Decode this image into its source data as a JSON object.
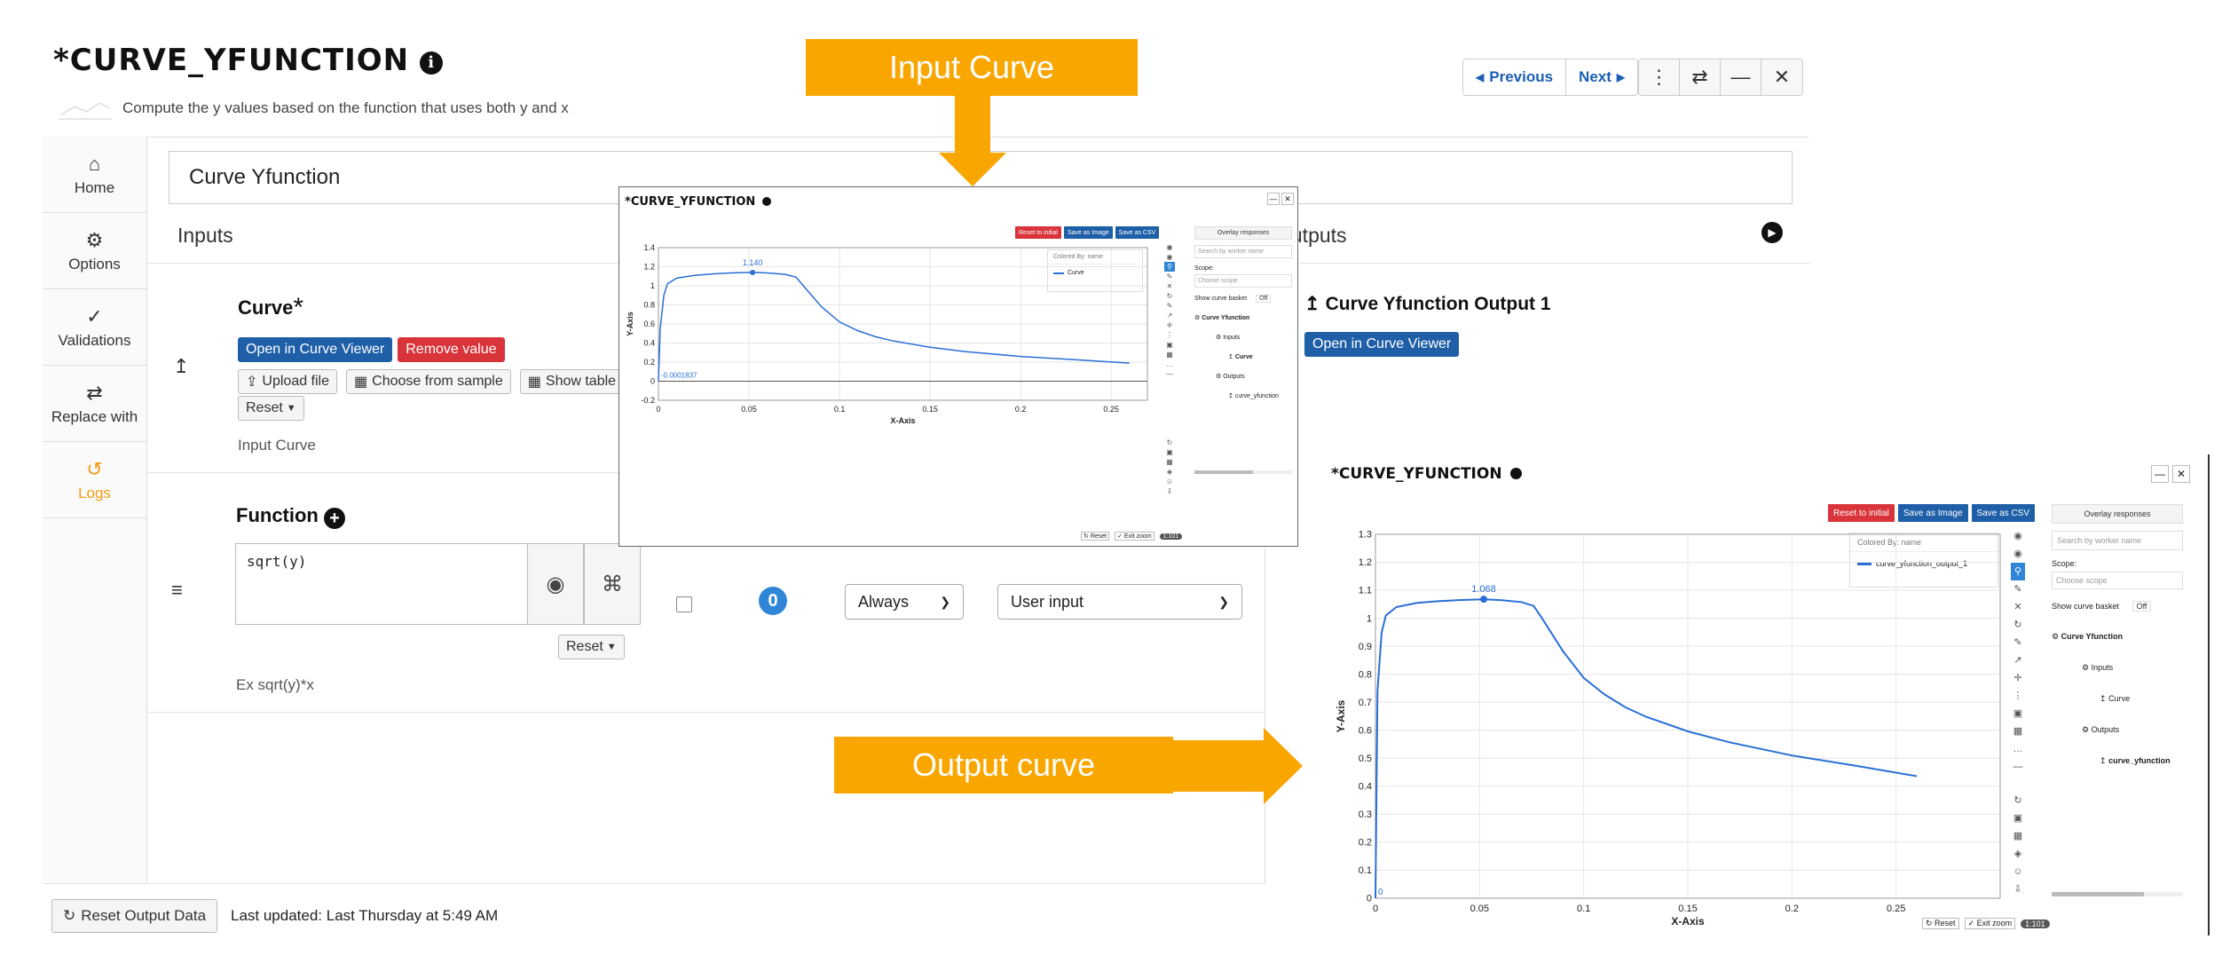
{
  "header": {
    "title_prefix": "*",
    "title": "CURVE_YFUNCTION",
    "info_glyph": "i",
    "subtitle": "Compute the y values based on the function that uses both y and x",
    "previous_label": "Previous",
    "next_label": "Next"
  },
  "sidebar": {
    "items": [
      {
        "icon": "home-icon",
        "label": "Home"
      },
      {
        "icon": "gear-icon",
        "label": "Options"
      },
      {
        "icon": "checks-icon",
        "label": "Validations"
      },
      {
        "icon": "swap-icon",
        "label": "Replace with"
      },
      {
        "icon": "history-icon",
        "label": "Logs",
        "color": "#f39c12"
      }
    ]
  },
  "form": {
    "name_value": "Curve Yfunction",
    "inputs_label": "Inputs",
    "outputs_label": "Outputs",
    "curve": {
      "title": "Curve",
      "required_mark": "*",
      "open_label": "Open in Curve Viewer",
      "remove_label": "Remove value",
      "upload_label": "Upload file",
      "sample_label": "Choose from sample",
      "table_label": "Show table",
      "reset_label": "Reset",
      "description": "Input Curve"
    },
    "function": {
      "title": "Function",
      "value": "sqrt(y)",
      "reset_label": "Reset",
      "example": "Ex sqrt(y)*x",
      "count": "0",
      "mode_select": "Always",
      "source_select": "User input"
    },
    "output": {
      "title": "Curve Yfunction Output 1",
      "open_label": "Open in Curve Viewer"
    },
    "footer": {
      "reset_label": "Reset Output Data",
      "updated": "Last updated: Last Thursday at 5:49 AM"
    }
  },
  "callouts": {
    "input": "Input Curve",
    "output": "Output curve",
    "color": "#f9a600"
  },
  "viewer": {
    "title": "CURVE_YFUNCTION",
    "title_prefix": "*",
    "reset_initial": "Reset to initial",
    "save_image": "Save as Image",
    "save_csv": "Save as CSV",
    "overlay": "Overlay responses",
    "search_placeholder": "Search by worker name",
    "scope_label": "Scope:",
    "scope_placeholder": "Choose scope",
    "basket_label": "Show curve basket",
    "basket_toggle": "Off",
    "colored_by": "Colored By: name",
    "tree_root": "Curve Yfunction",
    "tree_inputs": "Inputs",
    "tree_curve": "Curve",
    "tree_outputs": "Outputs",
    "tree_output_item": "curve_yfunction",
    "reset_small": "Reset",
    "exit_zoom": "Exit zoom",
    "toggle_tag": "1:101",
    "colors": {
      "red": "#d9343a",
      "blue": "#1f5fa8",
      "curve": "#2a6fd6"
    }
  },
  "chart_data": [
    {
      "type": "line",
      "xlabel": "X-Axis",
      "ylabel": "Y-Axis",
      "xlim": [
        0,
        0.27
      ],
      "ylim": [
        -0.2,
        1.4
      ],
      "xticks": [
        0,
        0.05,
        0.1,
        0.15,
        0.2,
        0.25
      ],
      "yticks": [
        -0.2,
        0,
        0.2,
        0.4,
        0.6,
        0.8,
        1,
        1.2,
        1.4
      ],
      "grid": true,
      "legend": "top-right",
      "series": [
        {
          "name": "Curve",
          "x": [
            0,
            0.001,
            0.003,
            0.005,
            0.01,
            0.02,
            0.03,
            0.04,
            0.052,
            0.06,
            0.07,
            0.076,
            0.08,
            0.09,
            0.1,
            0.11,
            0.12,
            0.13,
            0.15,
            0.17,
            0.2,
            0.23,
            0.26
          ],
          "y": [
            -0.0001837,
            0.55,
            0.9,
            1.02,
            1.08,
            1.11,
            1.125,
            1.135,
            1.14,
            1.135,
            1.12,
            1.09,
            1.0,
            0.78,
            0.62,
            0.53,
            0.465,
            0.42,
            0.355,
            0.31,
            0.26,
            0.225,
            0.19
          ]
        }
      ],
      "annotations": [
        {
          "x": 0.052,
          "y": 1.14,
          "text": "1.140"
        },
        {
          "x": 0,
          "y": -0.0001837,
          "text": "-0.0001837"
        }
      ]
    },
    {
      "type": "line",
      "xlabel": "X-Axis",
      "ylabel": "Y-Axis",
      "xlim": [
        0,
        0.3
      ],
      "ylim": [
        0,
        1.3
      ],
      "xticks": [
        0,
        0.05,
        0.1,
        0.15,
        0.2,
        0.25
      ],
      "yticks": [
        0,
        0.1,
        0.2,
        0.3,
        0.4,
        0.5,
        0.6,
        0.7,
        0.8,
        0.9,
        1,
        1.1,
        1.2,
        1.3
      ],
      "grid": true,
      "legend": "top-right",
      "series": [
        {
          "name": "curve_yfunction_output_1",
          "x": [
            0,
            0.001,
            0.003,
            0.005,
            0.01,
            0.02,
            0.03,
            0.04,
            0.052,
            0.06,
            0.07,
            0.076,
            0.08,
            0.09,
            0.1,
            0.11,
            0.12,
            0.13,
            0.15,
            0.17,
            0.2,
            0.23,
            0.26
          ],
          "y": [
            0,
            0.74,
            0.95,
            1.01,
            1.04,
            1.055,
            1.061,
            1.065,
            1.068,
            1.065,
            1.058,
            1.044,
            1.0,
            0.883,
            0.787,
            0.728,
            0.682,
            0.648,
            0.596,
            0.557,
            0.51,
            0.474,
            0.436
          ]
        }
      ],
      "annotations": [
        {
          "x": 0.052,
          "y": 1.068,
          "text": "1.068"
        },
        {
          "x": 0,
          "y": 0,
          "text": "0"
        }
      ]
    }
  ]
}
